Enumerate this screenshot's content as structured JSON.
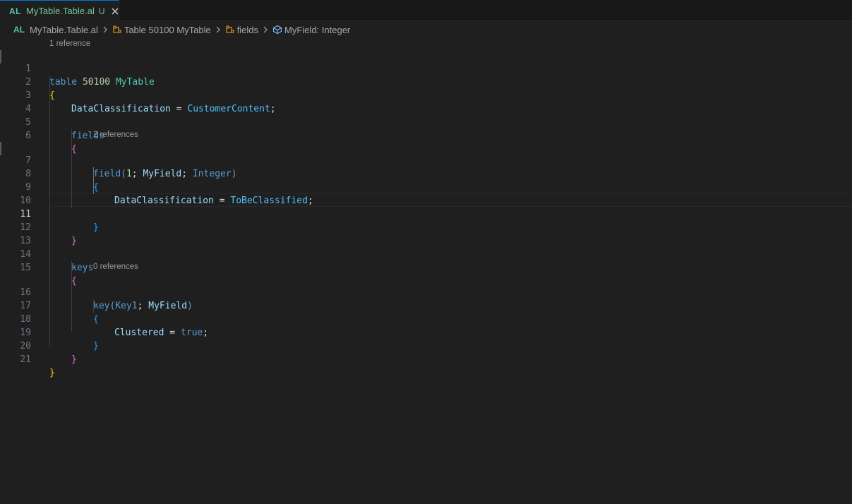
{
  "tab": {
    "lang": "AL",
    "filename": "MyTable.Table.al",
    "status": "U",
    "close_icon": "close-icon"
  },
  "breadcrumb": {
    "lang": "AL",
    "items": [
      "MyTable.Table.al",
      "Table 50100 MyTable",
      "fields",
      "MyField: Integer"
    ]
  },
  "codelens": {
    "table": "1 reference",
    "field": "2 references",
    "key": "0 references"
  },
  "editor": {
    "active_line": 11,
    "line_numbers": [
      "1",
      "2",
      "3",
      "4",
      "5",
      "6",
      "7",
      "8",
      "9",
      "10",
      "11",
      "12",
      "13",
      "14",
      "15",
      "16",
      "17",
      "18",
      "19",
      "20",
      "21"
    ],
    "tokens": {
      "l1": [
        "table",
        "50100",
        "MyTable"
      ],
      "l2": [
        "{"
      ],
      "l3": [
        "DataClassification",
        "=",
        "CustomerContent",
        ";"
      ],
      "l5": [
        "fields"
      ],
      "l6": [
        "{"
      ],
      "l7": [
        "field",
        "(",
        "1",
        ";",
        "MyField",
        ";",
        "Integer",
        ")"
      ],
      "l8": [
        "{"
      ],
      "l9": [
        "DataClassification",
        "=",
        "ToBeClassified",
        ";"
      ],
      "l11": [
        "}"
      ],
      "l12": [
        "}"
      ],
      "l14": [
        "keys"
      ],
      "l15": [
        "{"
      ],
      "l16": [
        "key",
        "(",
        "Key1",
        ";",
        "MyField",
        ")"
      ],
      "l17": [
        "{"
      ],
      "l18": [
        "Clustered",
        "=",
        "true",
        ";"
      ],
      "l19": [
        "}"
      ],
      "l20": [
        "}"
      ],
      "l21": [
        "}"
      ]
    }
  },
  "colors": {
    "background": "#1f1f1f",
    "keyword": "#569cd6",
    "type": "#4ec9b0",
    "property": "#9cdcfe",
    "bracket_level1": "#ffd700",
    "bracket_level2": "#da70d6",
    "bracket_level3": "#179fff"
  }
}
